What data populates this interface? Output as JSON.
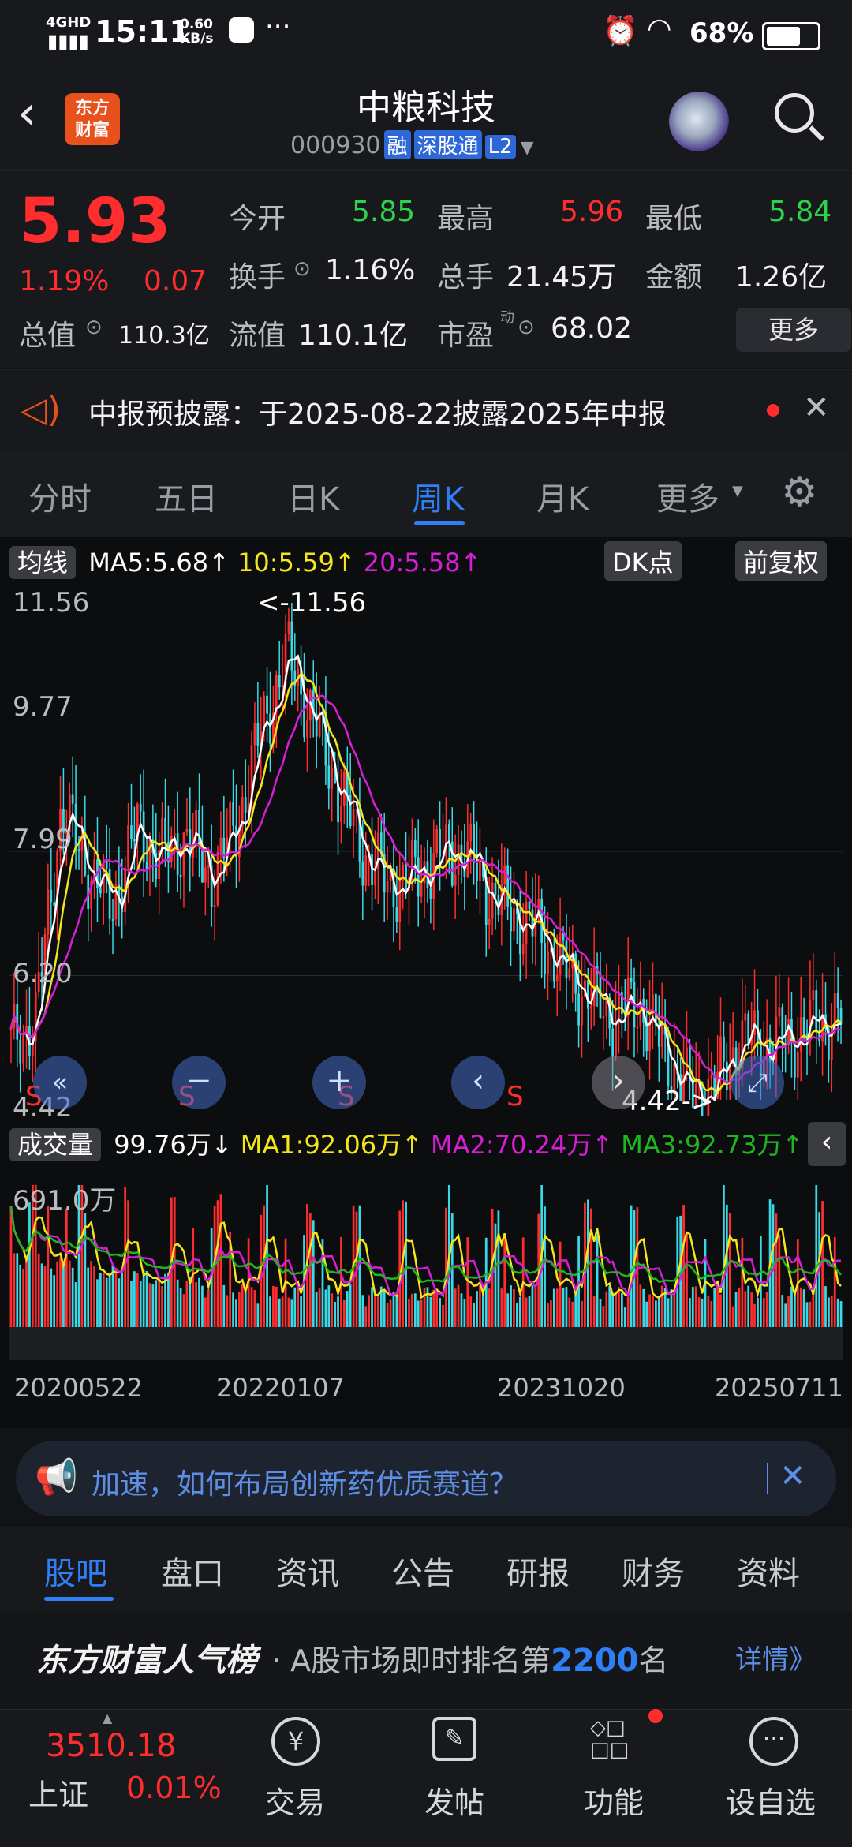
{
  "status_bar": {
    "network": "4GHD",
    "time": "15:11",
    "speed_value": "0.60",
    "speed_unit": "KB/s",
    "battery": "68%",
    "battery_level": 0.68
  },
  "header": {
    "logo_text_1": "东方",
    "logo_text_2": "财富",
    "title": "中粮科技",
    "code": "000930",
    "tags": [
      "融",
      "深股通",
      "L2"
    ]
  },
  "quote": {
    "price": "5.93",
    "change_pct": "1.19%",
    "change": "0.07",
    "open_label": "今开",
    "open": "5.85",
    "high_label": "最高",
    "high": "5.96",
    "low_label": "最低",
    "low": "5.84",
    "turnover_label": "换手",
    "turnover": "1.16%",
    "volume_label": "总手",
    "volume": "21.45万",
    "amount_label": "金额",
    "amount": "1.26亿",
    "mktcap_label": "总值",
    "mktcap": "110.3亿",
    "float_label": "流值",
    "float_cap": "110.1亿",
    "pe_label": "市盈",
    "pe_sup": "动",
    "pe": "68.02",
    "more_label": "更多"
  },
  "notice": {
    "text": "中报预披露：于2025-08-22披露2025年中报"
  },
  "period_tabs": [
    "分时",
    "五日",
    "日K",
    "周K",
    "月K",
    "更多"
  ],
  "active_period": "周K",
  "kline": {
    "indicator": "均线",
    "ma5": "MA5:5.68↑",
    "ma10": "10:5.59↑",
    "ma20": "20:5.58↑",
    "dk_label": "DK点",
    "adjust_label": "前复权",
    "y_labels": [
      "11.56",
      "9.77",
      "7.99",
      "6.20",
      "4.42"
    ],
    "max_marker": "<-11.56",
    "min_marker": "4.42->",
    "sell_marker": "S"
  },
  "volume": {
    "indicator": "成交量",
    "current": "99.76万↓",
    "ma1": "MA1:92.06万↑",
    "ma2": "MA2:70.24万↑",
    "ma3": "MA3:92.73万↑",
    "max_label": "691.0万"
  },
  "x_dates": [
    "20200522",
    "20220107",
    "20231020",
    "20250711"
  ],
  "ad": {
    "text": "加速，如何布局创新药优质赛道？"
  },
  "bottom_tabs": [
    "股吧",
    "盘口",
    "资讯",
    "公告",
    "研报",
    "财务",
    "资料"
  ],
  "active_bottom_tab": "股吧",
  "rank": {
    "brand": "东方财富人气榜",
    "text": "· A股市场即时排名第",
    "number": "2200",
    "suffix": "名",
    "link": "详情》"
  },
  "nav": {
    "index_value": "3510.18",
    "index_name": "上证",
    "index_change": "0.01%",
    "items": [
      "交易",
      "发帖",
      "功能",
      "设自选"
    ]
  },
  "colors": {
    "up": "#ff2d2d",
    "down": "#2ed14a",
    "accent": "#2f7ff7",
    "ma5": "#ffffff",
    "ma10": "#f5e51c",
    "ma20": "#d61ed6",
    "ma3": "#21b621"
  },
  "chart_data": {
    "type": "candlestick",
    "ylim": [
      4.42,
      11.56
    ],
    "x_labels": [
      "20200522",
      "20220107",
      "20231020",
      "20250711"
    ],
    "close_trend": [
      5.2,
      5.6,
      8.6,
      7.8,
      7.2,
      8.3,
      7.9,
      8.2,
      7.6,
      8.4,
      9.8,
      10.8,
      9.9,
      8.9,
      8.0,
      7.5,
      7.6,
      7.9,
      8.0,
      7.4,
      7.1,
      6.8,
      6.3,
      5.9,
      5.6,
      5.8,
      5.1,
      4.5,
      4.6,
      5.3,
      5.2,
      5.3,
      5.5,
      5.6
    ],
    "max": 11.56,
    "min": 4.42
  }
}
